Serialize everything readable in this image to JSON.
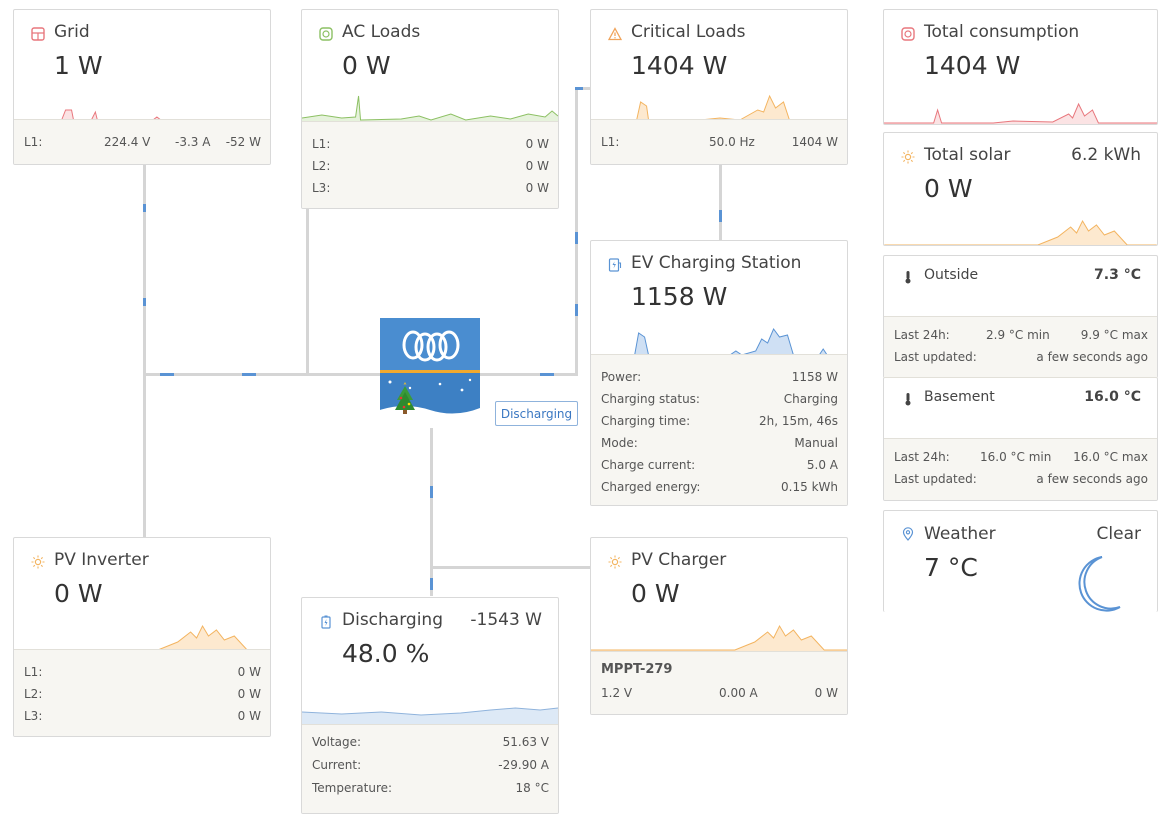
{
  "grid": {
    "title": "Grid",
    "value": "1 W",
    "icon": "grid-icon",
    "rows": [
      {
        "k": "L1:",
        "a": "224.4 V",
        "b": "-3.3 A",
        "c": "-52 W"
      }
    ]
  },
  "ac_loads": {
    "title": "AC Loads",
    "value": "0 W",
    "icon": "plug-icon",
    "rows": [
      {
        "k": "L1:",
        "v": "0 W"
      },
      {
        "k": "L2:",
        "v": "0 W"
      },
      {
        "k": "L3:",
        "v": "0 W"
      }
    ]
  },
  "critical_loads": {
    "title": "Critical Loads",
    "value": "1404 W",
    "icon": "warning-icon",
    "rows": [
      {
        "k": "L1:",
        "a": "50.0 Hz",
        "b": "1404 W"
      }
    ]
  },
  "total_consumption": {
    "title": "Total consumption",
    "value": "1404 W",
    "icon": "plug-icon"
  },
  "total_solar": {
    "title": "Total solar",
    "value": "0 W",
    "energy": "6.2 kWh",
    "icon": "sun-icon"
  },
  "ev": {
    "title": "EV Charging Station",
    "value": "1158 W",
    "icon": "ev-charger-icon",
    "rows": [
      {
        "k": "Power:",
        "v": "1158 W"
      },
      {
        "k": "Charging status:",
        "v": "Charging"
      },
      {
        "k": "Charging time:",
        "v": "2h, 15m, 46s"
      },
      {
        "k": "Mode:",
        "v": "Manual"
      },
      {
        "k": "Charge current:",
        "v": "5.0 A"
      },
      {
        "k": "Charged energy:",
        "v": "0.15 kWh"
      }
    ]
  },
  "outside": {
    "title": "Outside",
    "temp": "7.3 °C",
    "icon": "thermometer-icon",
    "rows": [
      {
        "k": "Last 24h:",
        "a": "2.9 °C min",
        "b": "9.9 °C max"
      },
      {
        "k": "Last updated:",
        "b": "a few seconds ago"
      }
    ]
  },
  "basement": {
    "title": "Basement",
    "temp": "16.0 °C",
    "icon": "thermometer-icon",
    "rows": [
      {
        "k": "Last 24h:",
        "a": "16.0 °C min",
        "b": "16.0 °C max"
      },
      {
        "k": "Last updated:",
        "b": "a few seconds ago"
      }
    ]
  },
  "weather": {
    "title": "Weather",
    "condition": "Clear",
    "temp": "7 °C",
    "icon": "location-pin-icon"
  },
  "pv_inverter": {
    "title": "PV Inverter",
    "value": "0 W",
    "icon": "sun-icon",
    "rows": [
      {
        "k": "L1:",
        "v": "0 W"
      },
      {
        "k": "L2:",
        "v": "0 W"
      },
      {
        "k": "L3:",
        "v": "0 W"
      }
    ]
  },
  "battery": {
    "title": "Discharging",
    "power": "-1543 W",
    "soc": "48.0 %",
    "icon": "battery-icon",
    "rows": [
      {
        "k": "Voltage:",
        "v": "51.63 V"
      },
      {
        "k": "Current:",
        "v": "-29.90 A"
      },
      {
        "k": "Temperature:",
        "v": "18 °C"
      }
    ]
  },
  "pv_charger": {
    "title": "PV Charger",
    "value": "0 W",
    "icon": "sun-icon",
    "device": "MPPT-279",
    "row": {
      "a": "1.2 V",
      "b": "0.00 A",
      "c": "0 W"
    }
  },
  "inverter": {
    "status": "Discharging"
  },
  "colors": {
    "grid": "#e8777d",
    "acloads": "#8cc063",
    "solar": "#f3b460",
    "ev": "#5a93d4",
    "battery": "#5a93d4"
  }
}
